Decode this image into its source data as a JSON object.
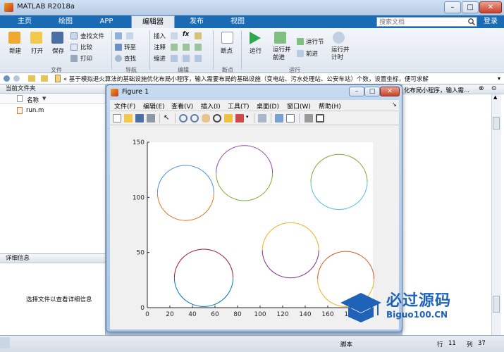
{
  "app": {
    "title": "MATLAB R2018a"
  },
  "window_buttons": [
    "–",
    "□",
    "✕"
  ],
  "tabs": [
    "主页",
    "绘图",
    "APP",
    "编辑器",
    "发布",
    "视图"
  ],
  "search": {
    "placeholder": "搜索文档"
  },
  "login_label": "登录",
  "ribbon": {
    "file": {
      "new": "新建",
      "open": "打开",
      "save": "保存",
      "find_files": "查找文件",
      "compare": "比较",
      "print": "打印",
      "section": "文件"
    },
    "nav": {
      "goto": "转至",
      "find": "查找",
      "section": "导航"
    },
    "edit": {
      "insert": "插入",
      "comment": "注释",
      "indent": "缩进",
      "fx": "fx",
      "section": "编辑"
    },
    "breakpoints": {
      "label": "断点",
      "section": "断点"
    },
    "run": {
      "run": "运行",
      "run_advance": "运行并\n前进",
      "run_section": "运行节",
      "advance": "前进",
      "run_time": "运行并\n计时",
      "section": "运行"
    }
  },
  "address": {
    "text": "« 基于模拟退火算法的基础设施优化布局小程序，输入需要布局的基础设施（变电站、污水处理站、公安车站）个数，设置坐标，便可求解"
  },
  "panes": {
    "current_folder": "当前文件夹",
    "name_col": "名称",
    "files": [
      "run.m"
    ],
    "details_title": "详细信息",
    "details_hint": "选择文件以查看详细信息",
    "right_snippet": "化布局小程序，输入需..."
  },
  "statusbar": {
    "script": "脚本",
    "row_label": "行",
    "row": "11",
    "col_label": "列",
    "col": "37"
  },
  "figure": {
    "title": "Figure 1",
    "menu": [
      "文件(F)",
      "编辑(E)",
      "查看(V)",
      "插入(I)",
      "工具(T)",
      "桌面(D)",
      "窗口(W)",
      "帮助(H)"
    ]
  },
  "watermark": {
    "line1": "必过源码",
    "line2": "Biguo100.CN"
  },
  "chart_data": {
    "type": "scatter",
    "title": "",
    "xlabel": "",
    "ylabel": "",
    "xlim": [
      0,
      200
    ],
    "ylim": [
      0,
      150
    ],
    "xticks": [
      0,
      20,
      40,
      60,
      80,
      100,
      120,
      140,
      160,
      180
    ],
    "yticks": [
      0,
      50,
      100,
      150
    ],
    "circles": [
      {
        "cx": 34,
        "cy": 104,
        "r": 25,
        "colors": [
          "#4a90d9",
          "#e0742a"
        ]
      },
      {
        "cx": 86,
        "cy": 122,
        "r": 25,
        "colors": [
          "#8e44ad",
          "#77ac30"
        ]
      },
      {
        "cx": 170,
        "cy": 114,
        "r": 25,
        "colors": [
          "#77ac30",
          "#4dbeee"
        ]
      },
      {
        "cx": 50,
        "cy": 27,
        "r": 26,
        "colors": [
          "#a2142f",
          "#0072bd"
        ]
      },
      {
        "cx": 127,
        "cy": 52,
        "r": 25,
        "colors": [
          "#edb120",
          "#7e2f8e"
        ]
      },
      {
        "cx": 176,
        "cy": 26,
        "r": 25,
        "colors": [
          "#d95319",
          "#edb120"
        ]
      }
    ]
  }
}
